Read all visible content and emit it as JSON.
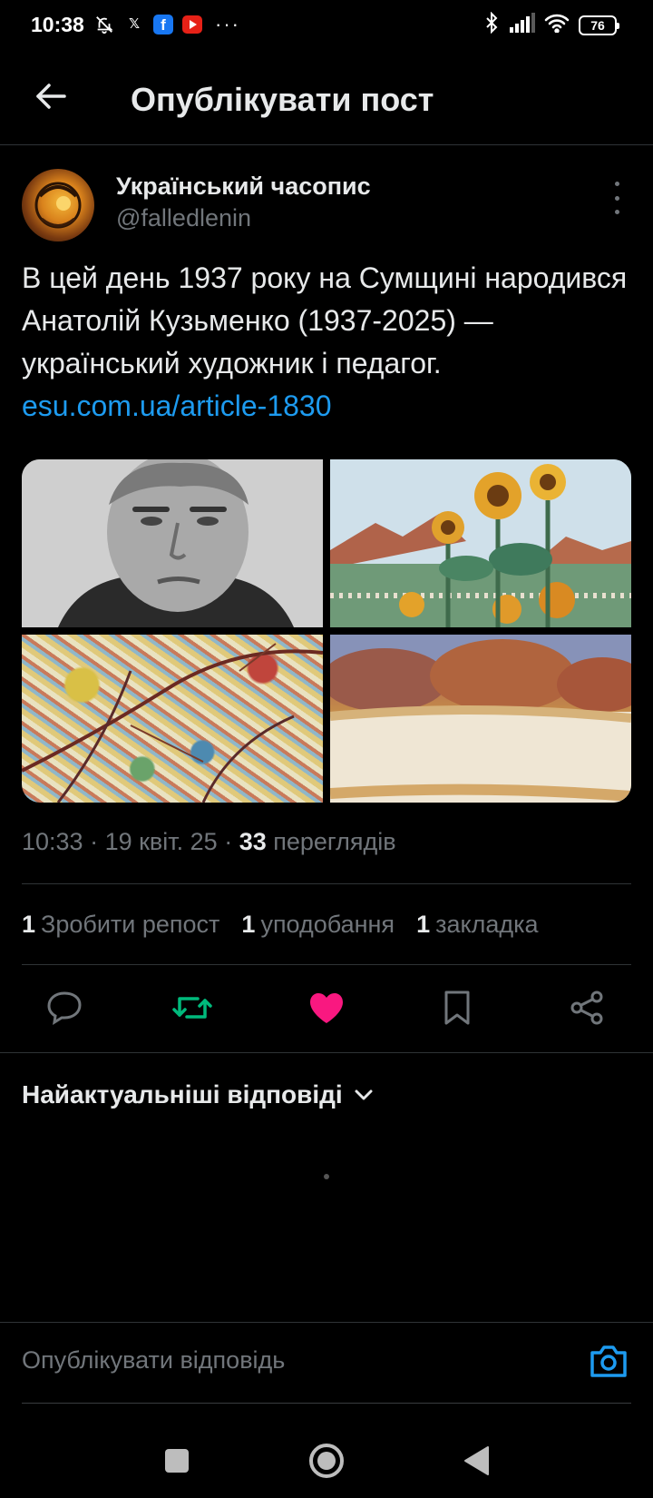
{
  "status_bar": {
    "time": "10:38",
    "battery": "76",
    "notif_icons": [
      "bell-off-icon",
      "x-app-icon",
      "facebook-icon",
      "youtube-icon",
      "more-dots-icon"
    ],
    "system_icons": [
      "bluetooth-icon",
      "signal-icon",
      "wifi-icon",
      "battery-icon"
    ]
  },
  "header": {
    "title": "Опублікувати пост"
  },
  "post": {
    "author_name": "Український часопис",
    "author_handle": "@falledlenin",
    "text": "В цей день 1937 року на Сумщині народився Анатолій Кузьменко (1937-2025) — український художник і педагог. ",
    "link": "esu.com.ua/article-1830",
    "time": "10:33",
    "date": "19 квіт. 25",
    "views_count": "33",
    "views_label": "переглядів",
    "stats": [
      {
        "count": "1",
        "label": "Зробити репост"
      },
      {
        "count": "1",
        "label": "уподобання"
      },
      {
        "count": "1",
        "label": "закладка"
      }
    ]
  },
  "colors": {
    "accent": "#1d9bf0",
    "repost": "#00ba7c",
    "like": "#f91880",
    "muted": "#71767b",
    "border": "#2f3336"
  },
  "replies": {
    "sort_label": "Найактуальніші відповіді"
  },
  "reply_bar": {
    "placeholder": "Опублікувати відповідь"
  }
}
